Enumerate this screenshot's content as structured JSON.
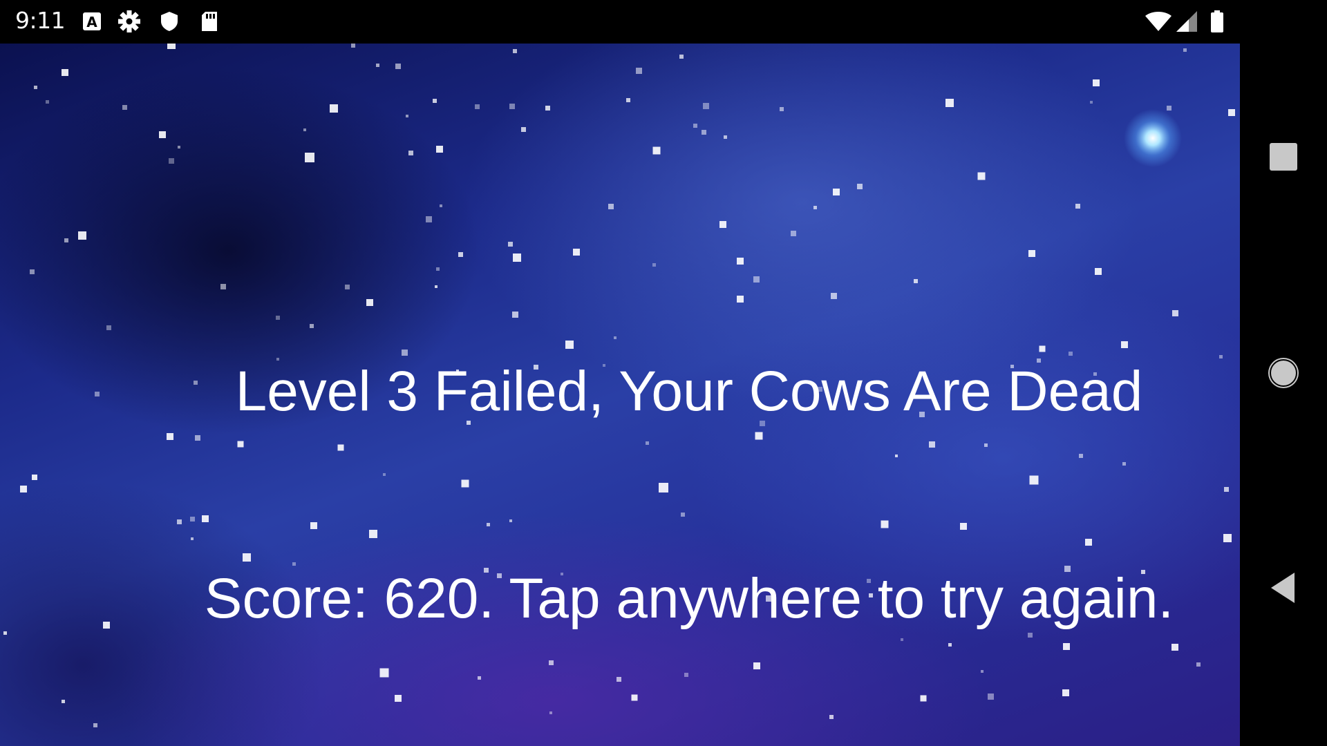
{
  "status_bar": {
    "time": "9:11",
    "icons_left": [
      "font-a-icon",
      "gear-icon",
      "shield-icon",
      "sd-card-icon"
    ],
    "icons_right": [
      "wifi-icon",
      "signal-icon",
      "battery-icon"
    ]
  },
  "game": {
    "headline": "Level 3 Failed, Your Cows Are Dead",
    "prompt": "Score: 620. Tap anywhere to try again.",
    "text_color": "#ffffff"
  },
  "nav_bar": {
    "buttons": [
      "recents-square-icon",
      "home-circle-icon",
      "back-triangle-icon"
    ]
  }
}
